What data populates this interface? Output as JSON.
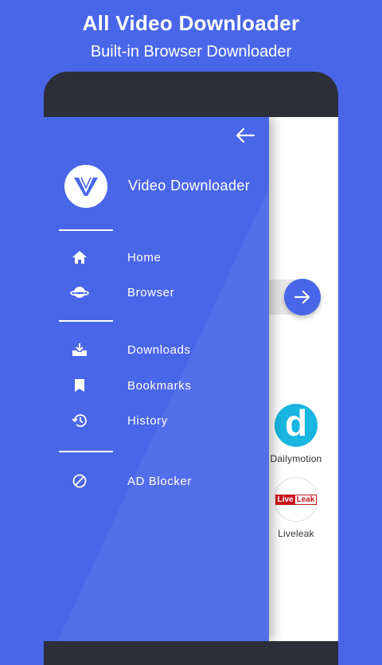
{
  "promo": {
    "title": "All Video Downloader",
    "subtitle": "Built-in Browser Downloader"
  },
  "drawer": {
    "app_name": "Video Downloader",
    "menu": {
      "home": "Home",
      "browser": "Browser",
      "downloads": "Downloads",
      "bookmarks": "Bookmarks",
      "history": "History",
      "ad_blocker": "AD Blocker"
    }
  },
  "sites": {
    "dailymotion": {
      "label": "Dailymotion",
      "logo_text": "d"
    },
    "liveleak": {
      "label": "Liveleak",
      "logo_text_a": "Live",
      "logo_text_b": "Leak"
    }
  },
  "colors": {
    "accent": "#4a66e8",
    "device": "#2c2f39",
    "dailymotion": "#18b6e0",
    "liveleak": "#c8161d"
  },
  "icons": [
    "back-arrow-icon",
    "app-logo",
    "home-icon",
    "planet-icon",
    "download-icon",
    "bookmark-icon",
    "history-icon",
    "block-icon",
    "arrow-right-icon"
  ]
}
